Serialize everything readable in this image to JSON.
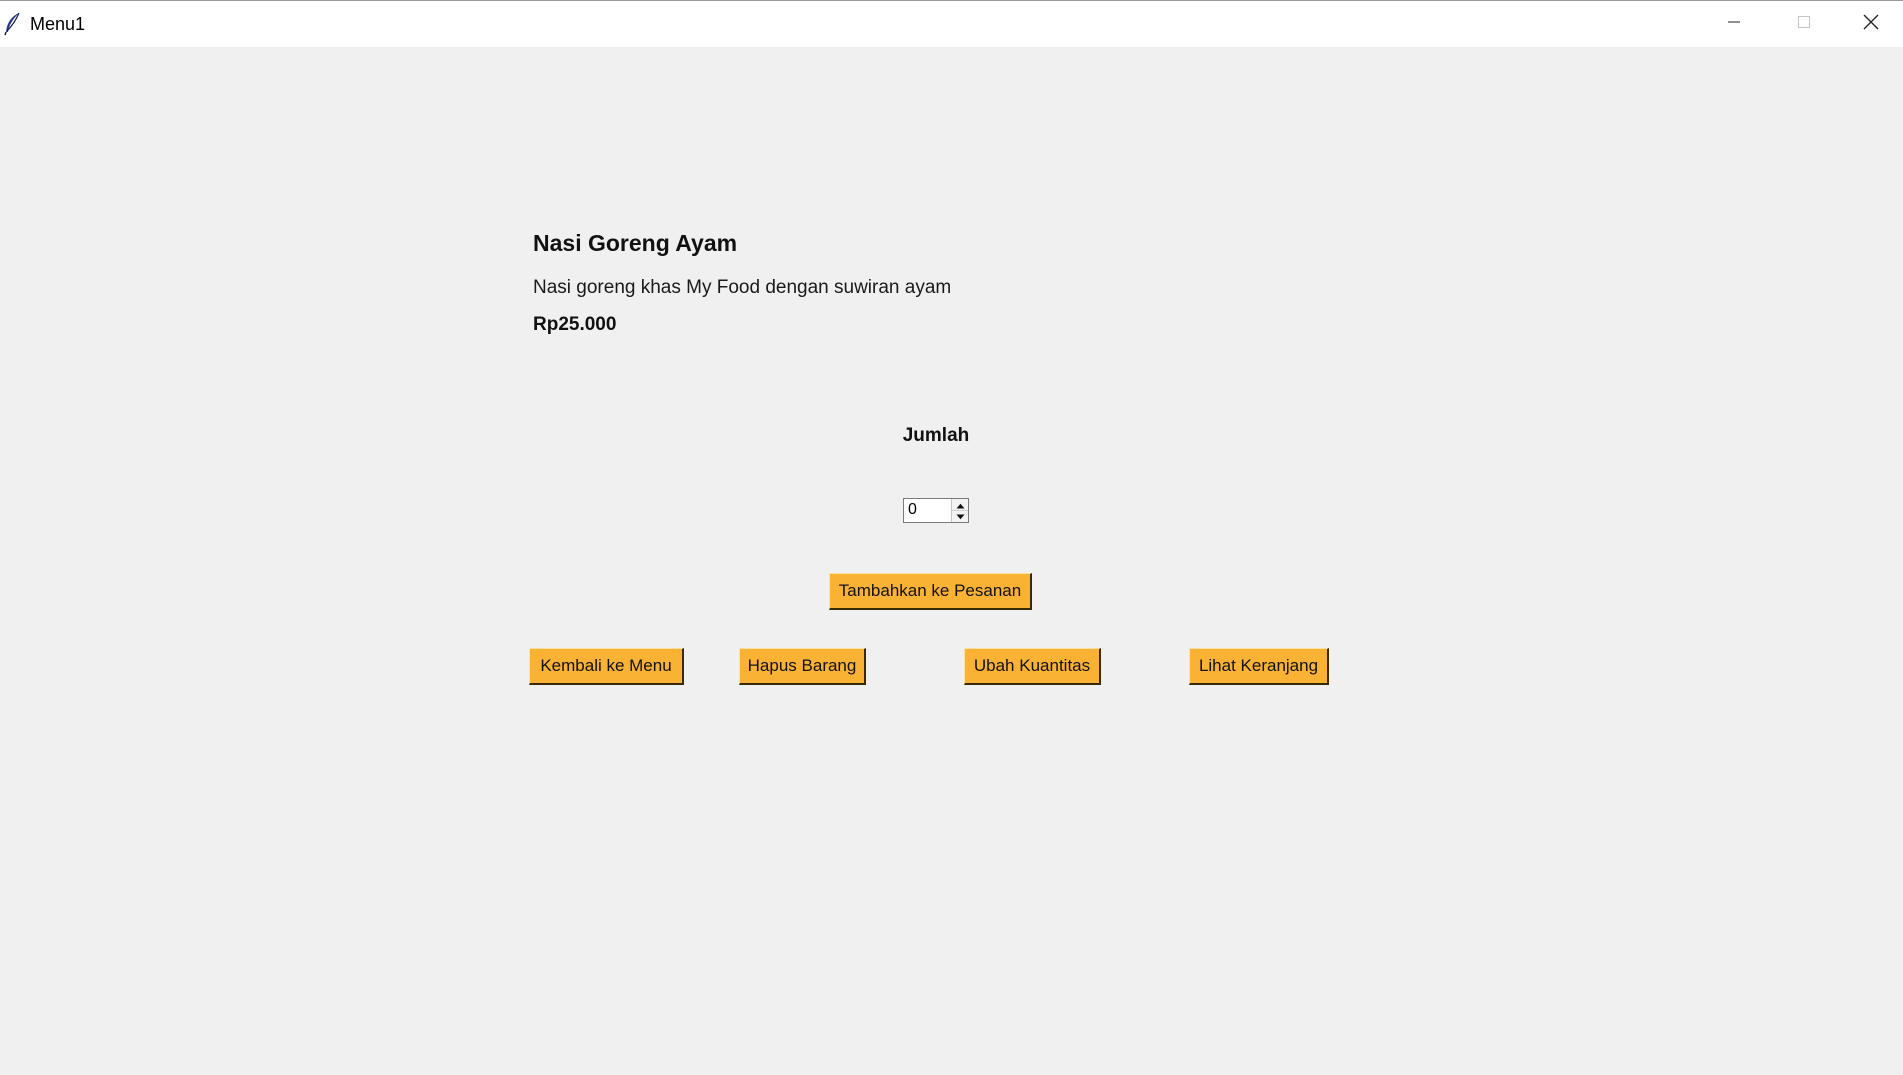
{
  "window": {
    "title": "Menu1",
    "icon": "feather-icon",
    "controls": [
      "minimize-icon",
      "maximize-icon",
      "close-icon"
    ]
  },
  "item": {
    "name": "Nasi Goreng Ayam",
    "description": "Nasi goreng khas My Food dengan suwiran ayam",
    "price": "Rp25.000"
  },
  "quantity": {
    "label": "Jumlah",
    "value": "0"
  },
  "buttons": {
    "add": "Tambahkan ke Pesanan",
    "back": "Kembali ke Menu",
    "remove": "Hapus Barang",
    "change_qty": "Ubah Kuantitas",
    "view_cart": "Lihat Keranjang"
  },
  "colors": {
    "background": "#f0f0f0",
    "button": "#f9b233"
  }
}
